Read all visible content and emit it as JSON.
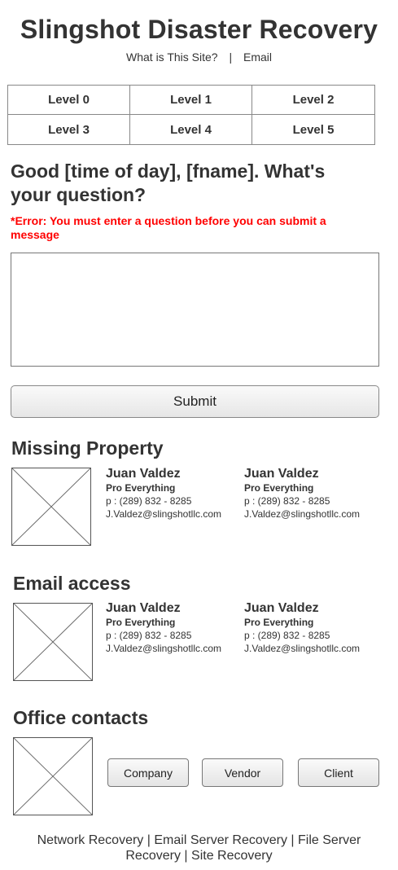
{
  "header": {
    "title": "Slingshot Disaster Recovery",
    "nav": [
      {
        "label": "What is This Site?"
      },
      {
        "label": "Email"
      }
    ],
    "nav_separator": "|"
  },
  "levels": [
    "Level 0",
    "Level 1",
    "Level 2",
    "Level 3",
    "Level 4",
    "Level 5"
  ],
  "question_form": {
    "greeting": "Good [time of day], [fname]. What's your question?",
    "error": "*Error: You must enter a question before you can submit a message",
    "textarea_value": "",
    "submit_label": "Submit"
  },
  "sections": {
    "missing_property": {
      "title": "Missing Property",
      "contacts": [
        {
          "name": "Juan Valdez",
          "role": "Pro Everything",
          "phone": "p : (289) 832 - 8285",
          "email": "J.Valdez@slingshotllc.com"
        },
        {
          "name": "Juan Valdez",
          "role": "Pro Everything",
          "phone": "p : (289) 832 - 8285",
          "email": "J.Valdez@slingshotllc.com"
        }
      ]
    },
    "email_access": {
      "title": "Email access",
      "contacts": [
        {
          "name": "Juan Valdez",
          "role": "Pro Everything",
          "phone": "p : (289) 832 - 8285",
          "email": "J.Valdez@slingshotllc.com"
        },
        {
          "name": "Juan Valdez",
          "role": "Pro Everything",
          "phone": "p : (289) 832 - 8285",
          "email": "J.Valdez@slingshotllc.com"
        }
      ]
    },
    "office_contacts": {
      "title": "Office contacts",
      "buttons": [
        "Company",
        "Vendor",
        "Client"
      ]
    }
  },
  "footer": {
    "links": [
      "Network Recovery",
      "Email Server Recovery",
      "File Server Recovery",
      "Site Recovery"
    ],
    "separator": "|"
  }
}
